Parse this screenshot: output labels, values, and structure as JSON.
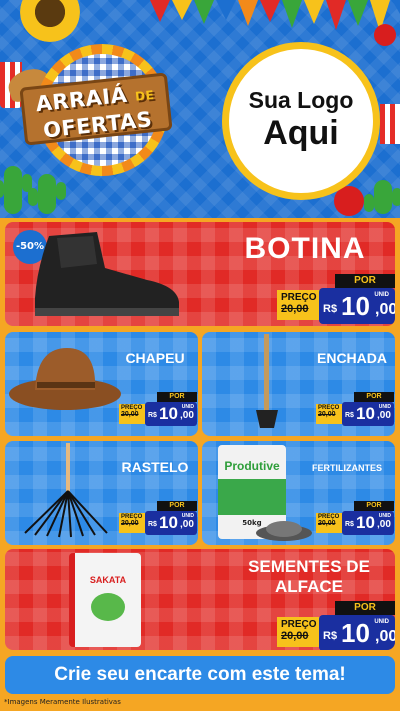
{
  "header": {
    "badge": {
      "line1": "ARRAIÁ",
      "de": "DE",
      "line2": "OFERTAS"
    },
    "logo_placeholder": {
      "line1": "Sua Logo",
      "line2": "Aqui"
    }
  },
  "products": [
    {
      "name": "BOTINA",
      "discount": "-50%",
      "por": "POR",
      "preco_label": "PREÇO",
      "old_price": "20,00",
      "currency": "R$",
      "price_int": "10",
      "price_cents": ",00",
      "unit": "UNID"
    },
    {
      "name": "CHAPEU",
      "por": "POR",
      "preco_label": "PREÇO",
      "old_price": "20,00",
      "currency": "R$",
      "price_int": "10",
      "price_cents": ",00",
      "unit": "UNID"
    },
    {
      "name": "ENCHADA",
      "por": "POR",
      "preco_label": "PREÇO",
      "old_price": "20,00",
      "currency": "R$",
      "price_int": "10",
      "price_cents": ",00",
      "unit": "UNID"
    },
    {
      "name": "RASTELO",
      "por": "POR",
      "preco_label": "PREÇO",
      "old_price": "20,00",
      "currency": "R$",
      "price_int": "10",
      "price_cents": ",00",
      "unit": "UNID"
    },
    {
      "name": "FERTILIZANTES",
      "bag_brand": "Produtive",
      "bag_weight": "50kg",
      "por": "POR",
      "preco_label": "PREÇO",
      "old_price": "20,00",
      "currency": "R$",
      "price_int": "10",
      "price_cents": ",00",
      "unit": "UNID"
    },
    {
      "name_line1": "SEMENTES DE",
      "name_line2": "ALFACE",
      "seed_brand": "SAKATA",
      "por": "POR",
      "preco_label": "PREÇO",
      "old_price": "20,00",
      "currency": "R$",
      "price_int": "10",
      "price_cents": ",00",
      "unit": "UNID"
    }
  ],
  "cta": "Crie seu encarte com este tema!",
  "disclaimer": "*Imagens Meramente Ilustrativas",
  "colors": {
    "red": "#e12a26",
    "blue": "#2d8ae6",
    "yellow": "#f7c21b",
    "orange": "#f5a623",
    "navy": "#1a2fa0"
  }
}
